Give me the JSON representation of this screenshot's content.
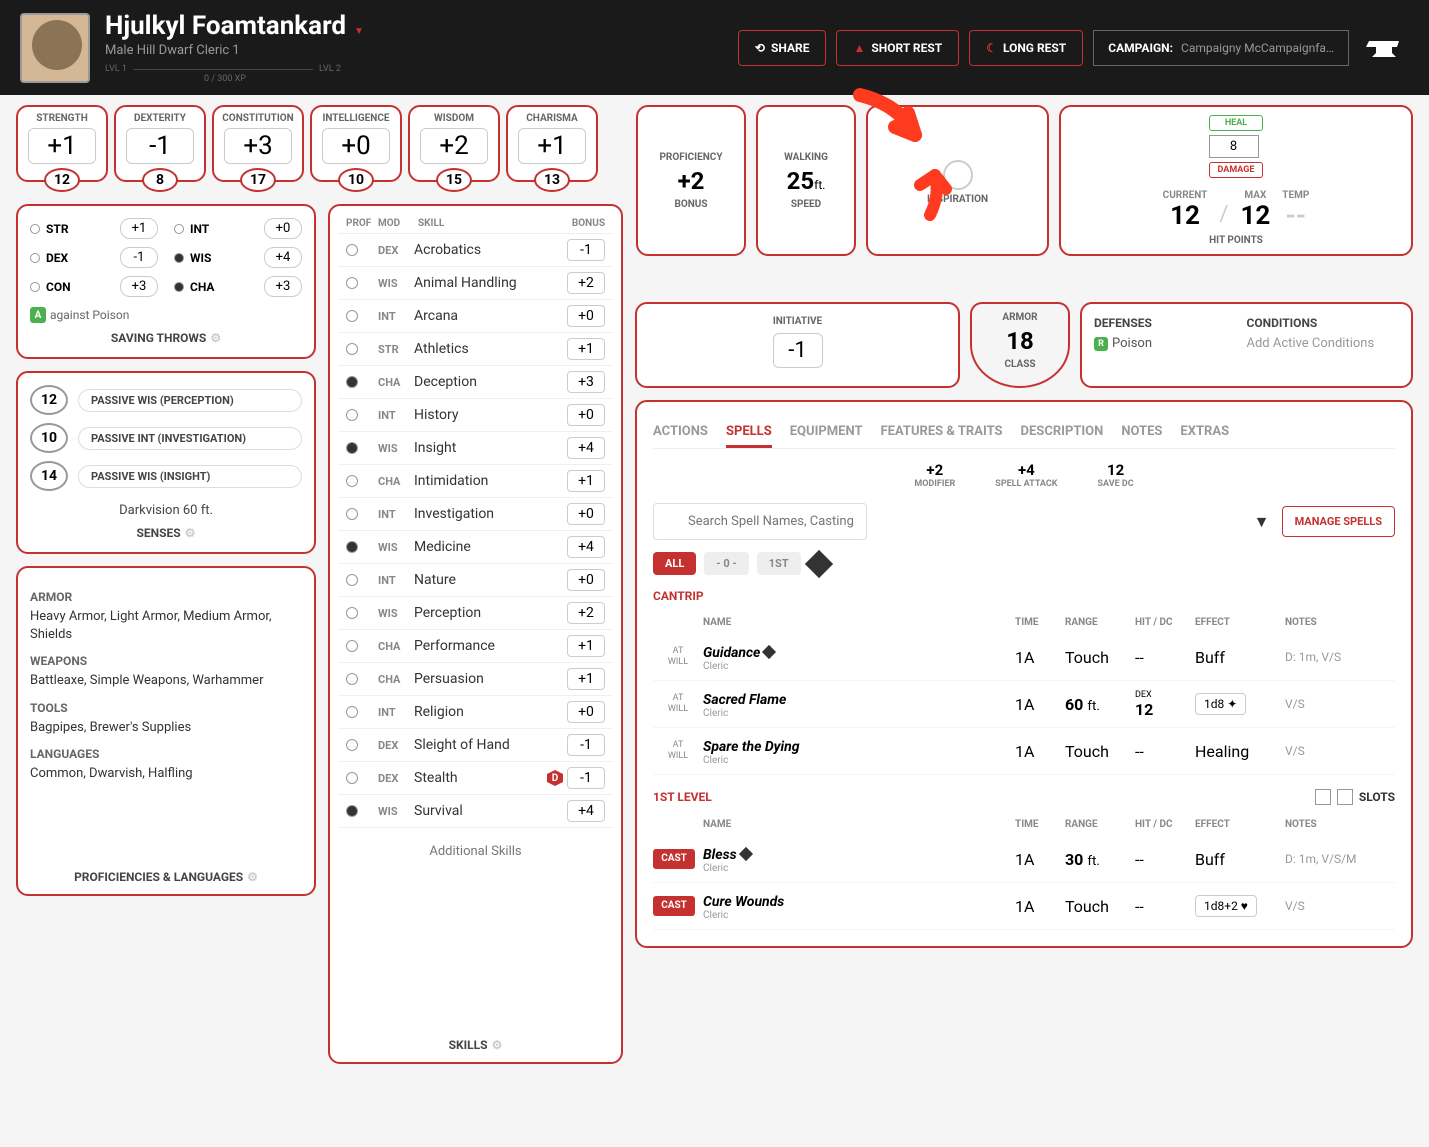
{
  "header": {
    "name": "Hjulkyl Foamtankard",
    "meta": "Male  Hill Dwarf  Cleric 1",
    "lvl1": "LVL 1",
    "lvl2": "LVL 2",
    "xp": "0 / 300 XP",
    "share": "SHARE",
    "short_rest": "SHORT REST",
    "long_rest": "LONG REST",
    "campaign_label": "CAMPAIGN:",
    "campaign_name": "Campaigny McCampaignfa…"
  },
  "abilities": [
    {
      "name": "STRENGTH",
      "mod": "+1",
      "score": "12"
    },
    {
      "name": "DEXTERITY",
      "mod": "-1",
      "score": "8"
    },
    {
      "name": "CONSTITUTION",
      "mod": "+3",
      "score": "17"
    },
    {
      "name": "INTELLIGENCE",
      "mod": "+0",
      "score": "10"
    },
    {
      "name": "WISDOM",
      "mod": "+2",
      "score": "15"
    },
    {
      "name": "CHARISMA",
      "mod": "+1",
      "score": "13"
    }
  ],
  "prof": {
    "label": "PROFICIENCY",
    "val": "+2",
    "sub": "BONUS"
  },
  "speed": {
    "label": "WALKING",
    "val": "25",
    "unit": "ft.",
    "sub": "SPEED"
  },
  "inspiration": "INSPIRATION",
  "hp": {
    "heal": "HEAL",
    "damage": "DAMAGE",
    "input": "8",
    "current_lbl": "CURRENT",
    "current": "12",
    "max_lbl": "MAX",
    "max": "12",
    "temp_lbl": "TEMP",
    "temp": "--",
    "title": "HIT POINTS"
  },
  "initiative": {
    "label": "INITIATIVE",
    "val": "-1"
  },
  "ac": {
    "label": "ARMOR",
    "val": "18",
    "sub": "CLASS"
  },
  "defenses": {
    "title": "DEFENSES",
    "poison": "Poison"
  },
  "conditions": {
    "title": "CONDITIONS",
    "add": "Add Active Conditions"
  },
  "saves": {
    "title": "SAVING THROWS",
    "items": [
      {
        "abbr": "STR",
        "val": "+1",
        "prof": false
      },
      {
        "abbr": "INT",
        "val": "+0",
        "prof": false
      },
      {
        "abbr": "DEX",
        "val": "-1",
        "prof": false
      },
      {
        "abbr": "WIS",
        "val": "+4",
        "prof": true
      },
      {
        "abbr": "CON",
        "val": "+3",
        "prof": false
      },
      {
        "abbr": "CHA",
        "val": "+3",
        "prof": true
      }
    ],
    "adv": "against Poison"
  },
  "senses": {
    "title": "SENSES",
    "passives": [
      {
        "val": "12",
        "label": "PASSIVE WIS (PERCEPTION)"
      },
      {
        "val": "10",
        "label": "PASSIVE INT (INVESTIGATION)"
      },
      {
        "val": "14",
        "label": "PASSIVE WIS (INSIGHT)"
      }
    ],
    "darkvision": "Darkvision 60 ft."
  },
  "profs": {
    "title": "PROFICIENCIES & LANGUAGES",
    "armor_h": "ARMOR",
    "armor": "Heavy Armor, Light Armor, Medium Armor, Shields",
    "weapons_h": "WEAPONS",
    "weapons": "Battleaxe, Simple Weapons, Warhammer",
    "tools_h": "TOOLS",
    "tools": "Bagpipes, Brewer's Supplies",
    "lang_h": "LANGUAGES",
    "lang": "Common, Dwarvish, Halfling"
  },
  "skills": {
    "title": "SKILLS",
    "header": {
      "prof": "PROF",
      "mod": "MOD",
      "skill": "SKILL",
      "bonus": "BONUS"
    },
    "addl": "Additional Skills",
    "items": [
      {
        "prof": false,
        "mod": "DEX",
        "name": "Acrobatics",
        "bonus": "-1"
      },
      {
        "prof": false,
        "mod": "WIS",
        "name": "Animal Handling",
        "bonus": "+2"
      },
      {
        "prof": false,
        "mod": "INT",
        "name": "Arcana",
        "bonus": "+0"
      },
      {
        "prof": false,
        "mod": "STR",
        "name": "Athletics",
        "bonus": "+1"
      },
      {
        "prof": true,
        "mod": "CHA",
        "name": "Deception",
        "bonus": "+3"
      },
      {
        "prof": false,
        "mod": "INT",
        "name": "History",
        "bonus": "+0"
      },
      {
        "prof": true,
        "mod": "WIS",
        "name": "Insight",
        "bonus": "+4"
      },
      {
        "prof": false,
        "mod": "CHA",
        "name": "Intimidation",
        "bonus": "+1"
      },
      {
        "prof": false,
        "mod": "INT",
        "name": "Investigation",
        "bonus": "+0"
      },
      {
        "prof": true,
        "mod": "WIS",
        "name": "Medicine",
        "bonus": "+4"
      },
      {
        "prof": false,
        "mod": "INT",
        "name": "Nature",
        "bonus": "+0"
      },
      {
        "prof": false,
        "mod": "WIS",
        "name": "Perception",
        "bonus": "+2"
      },
      {
        "prof": false,
        "mod": "CHA",
        "name": "Performance",
        "bonus": "+1"
      },
      {
        "prof": false,
        "mod": "CHA",
        "name": "Persuasion",
        "bonus": "+1"
      },
      {
        "prof": false,
        "mod": "INT",
        "name": "Religion",
        "bonus": "+0"
      },
      {
        "prof": false,
        "mod": "DEX",
        "name": "Sleight of Hand",
        "bonus": "-1"
      },
      {
        "prof": false,
        "mod": "DEX",
        "name": "Stealth",
        "bonus": "-1",
        "disadv": true
      },
      {
        "prof": true,
        "mod": "WIS",
        "name": "Survival",
        "bonus": "+4"
      }
    ]
  },
  "tabs": [
    "ACTIONS",
    "SPELLS",
    "EQUIPMENT",
    "FEATURES & TRAITS",
    "DESCRIPTION",
    "NOTES",
    "EXTRAS"
  ],
  "active_tab": "SPELLS",
  "spell_stats": [
    {
      "val": "+2",
      "lbl": "MODIFIER"
    },
    {
      "val": "+4",
      "lbl": "SPELL ATTACK"
    },
    {
      "val": "12",
      "lbl": "SAVE DC"
    }
  ],
  "search_placeholder": "Search Spell Names, Casting Times, Damage Types, Conditions or Tags",
  "manage": "MANAGE SPELLS",
  "level_filters": {
    "all": "ALL",
    "zero": "- 0 -",
    "one": "1ST"
  },
  "spell_cols": {
    "name": "NAME",
    "time": "TIME",
    "range": "RANGE",
    "hit": "HIT / DC",
    "effect": "EFFECT",
    "notes": "NOTES"
  },
  "cantrip_hdr": "CANTRIP",
  "first_hdr": "1ST LEVEL",
  "slots_lbl": "SLOTS",
  "at_will": "AT WILL",
  "cast": "CAST",
  "cantrips": [
    {
      "name": "Guidance",
      "src": "Cleric",
      "conc": true,
      "time": "1A",
      "range": "Touch",
      "hit": "--",
      "effect": "Buff",
      "notes": "D: 1m, V/S"
    },
    {
      "name": "Sacred Flame",
      "src": "Cleric",
      "time": "1A",
      "range": "60",
      "range_unit": "ft.",
      "hit": "DEX 12",
      "effect": "1d8 ✦",
      "effect_box": true,
      "notes": "V/S"
    },
    {
      "name": "Spare the Dying",
      "src": "Cleric",
      "time": "1A",
      "range": "Touch",
      "hit": "--",
      "effect": "Healing",
      "notes": "V/S"
    }
  ],
  "first_level": [
    {
      "name": "Bless",
      "src": "Cleric",
      "conc": true,
      "time": "1A",
      "range": "30",
      "range_unit": "ft.",
      "hit": "--",
      "effect": "Buff",
      "notes": "D: 1m, V/S/M"
    },
    {
      "name": "Cure Wounds",
      "src": "Cleric",
      "time": "1A",
      "range": "Touch",
      "hit": "--",
      "effect": "1d8+2 ♥",
      "effect_box": true,
      "notes": "V/S"
    }
  ]
}
